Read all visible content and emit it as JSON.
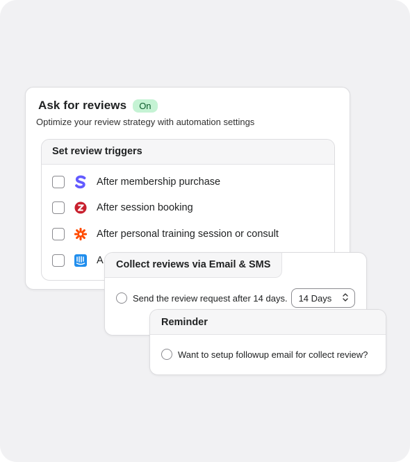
{
  "ask": {
    "title": "Ask for reviews",
    "status_badge": "On",
    "subtitle": "Optimize your review strategy with automation settings"
  },
  "triggers": {
    "heading": "Set review triggers",
    "items": [
      {
        "label": "After membership purchase",
        "icon": "stripe-s-icon",
        "color": "#635bff",
        "checked": false
      },
      {
        "label": "After session booking",
        "icon": "zoom-z-icon",
        "color": "#c8202e",
        "checked": false
      },
      {
        "label": "After personal training session or consult",
        "icon": "zapier-asterisk-icon",
        "color": "#ff4a00",
        "checked": false
      },
      {
        "label": "A",
        "icon": "intercom-icon",
        "color": "#1f8ded",
        "checked": false
      }
    ]
  },
  "email_sms": {
    "title": "Collect reviews via Email & SMS",
    "option_label": "Send the review request after 14 days.",
    "select_value": "14 Days"
  },
  "reminder": {
    "title": "Reminder",
    "option_label": "Want to setup followup email for collect review?"
  },
  "colors": {
    "badge_bg": "#c5f3d4",
    "badge_text": "#0b5a2a",
    "background": "#f1f1f3"
  }
}
